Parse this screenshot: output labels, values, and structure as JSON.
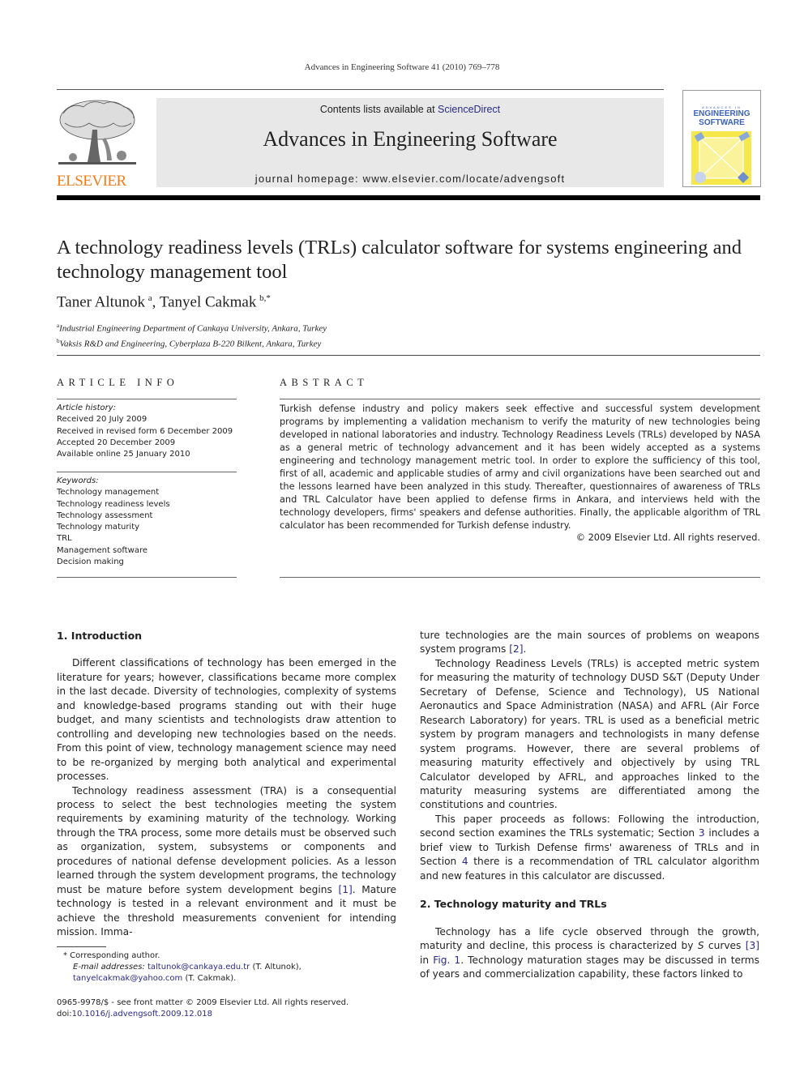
{
  "header": {
    "running_head": "Advances in Engineering Software 41 (2010) 769–778",
    "contents_prefix": "Contents lists available at ",
    "contents_link": "ScienceDirect",
    "journal_name": "Advances in Engineering Software",
    "homepage": "journal homepage: www.elsevier.com/locate/advengsoft",
    "publisher_logo_text": "ELSEVIER",
    "cover": {
      "top_line": "ADVANCES IN",
      "line1": "ENGINEERING",
      "line2": "SOFTWARE"
    },
    "colors": {
      "publisher_orange": "#f07c1a",
      "link_blue": "#2a2a8c",
      "masthead_gray": "#e8e8e8",
      "cover_yellow": "#f6e84a"
    }
  },
  "article": {
    "title": "A technology readiness levels (TRLs) calculator software for systems engineering and technology management tool",
    "authors": [
      {
        "name": "Taner Altunok",
        "sup": "a"
      },
      {
        "name": "Tanyel Cakmak",
        "sup": "b,*"
      }
    ],
    "affiliations": [
      {
        "sup": "a",
        "text": "Industrial Engineering Department of Cankaya University, Ankara, Turkey"
      },
      {
        "sup": "b",
        "text": "Vaksis R&D and Engineering, Cyberplaza B-220 Bilkent, Ankara, Turkey"
      }
    ]
  },
  "article_info": {
    "heading": "ARTICLE INFO",
    "history_label": "Article history:",
    "history": [
      "Received 20 July 2009",
      "Received in revised form 6 December 2009",
      "Accepted 20 December 2009",
      "Available online 25 January 2010"
    ],
    "keywords_label": "Keywords:",
    "keywords": [
      "Technology management",
      "Technology readiness levels",
      "Technology assessment",
      "Technology maturity",
      "TRL",
      "Management software",
      "Decision making"
    ]
  },
  "abstract": {
    "heading": "ABSTRACT",
    "text": "Turkish defense industry and policy makers seek effective and successful system development programs by implementing a validation mechanism to verify the maturity of new technologies being developed in national laboratories and industry. Technology Readiness Levels (TRLs) developed by NASA as a general metric of technology advancement and it has been widely accepted as a systems engineering and technology management metric tool. In order to explore the sufficiency of this tool, first of all, academic and applicable studies of army and civil organizations have been searched out and the lessons learned have been analyzed in this study. Thereafter, questionnaires of awareness of TRLs and TRL Calculator have been applied to defense firms in Ankara, and interviews held with the technology developers, firms' speakers and defense authorities. Finally, the applicable algorithm of TRL calculator has been recommended for Turkish defense industry.",
    "copyright": "© 2009 Elsevier Ltd. All rights reserved."
  },
  "body": {
    "section1_heading": "1. Introduction",
    "p1": "Different classifications of technology has been emerged in the literature for years; however, classifications became more complex in the last decade. Diversity of technologies, complexity of systems and knowledge-based programs standing out with their huge budget, and many scientists and technologists draw attention to controlling and developing new technologies based on the needs. From this point of view, technology management science may need to be re-organized by merging both analytical and experimental processes.",
    "p2_a": "Technology readiness assessment (TRA) is a consequential process to select the best technologies meeting the system requirements by examining maturity of the technology. Working through the TRA process, some more details must be observed such as organization, system, subsystems or components and procedures of national defense development policies. As a lesson learned through the system development programs, the technology must be mature before system development begins ",
    "p2_ref": "[1]",
    "p2_b": ". Mature technology is tested in a relevant environment and it must be achieve the threshold measurements convenient for intending mission. Immature technologies are the main sources of problems on weapons system programs ",
    "p2_ref2": "[2]",
    "p2_c": ".",
    "p3": "Technology Readiness Levels (TRLs) is accepted metric system for measuring the maturity of technology DUSD S&T (Deputy Under Secretary of Defense, Science and Technology), US National Aeronautics and Space Administration (NASA) and AFRL (Air Force Research Laboratory) for years. TRL is used as a beneficial metric system by program managers and technologists in many defense system programs. However, there are several problems of measuring maturity effectively and objectively by using TRL Calculator developed by AFRL, and approaches linked to the maturity measuring systems are differentiated among the constitutions and countries.",
    "p4_a": "This paper proceeds as follows: Following the introduction, second section examines the TRLs systematic; Section ",
    "p4_ref1": "3",
    "p4_b": " includes a brief view to Turkish Defense firms' awareness of TRLs and in Section ",
    "p4_ref2": "4",
    "p4_c": " there is a recommendation of TRL calculator algorithm and new features in this calculator are discussed.",
    "section2_heading": "2. Technology maturity and TRLs",
    "p5_a": "Technology has a life cycle observed through the growth, maturity and decline, this process is characterized by ",
    "p5_s": "S",
    "p5_b": " curves ",
    "p5_ref": "[3]",
    "p5_c": " in ",
    "p5_fig": "Fig. 1",
    "p5_d": ". Technology maturation stages may be discussed in terms of years and commercialization capability, these factors linked to"
  },
  "footnotes": {
    "star": "* Corresponding author.",
    "email_label": "E-mail addresses:",
    "email1": "taltunok@cankaya.edu.tr",
    "email1_who": " (T. Altunok), ",
    "email2": "tanyelcakmak@yahoo.com",
    "email2_who": " (T. Cakmak).",
    "issn": "0965-9978/$ - see front matter © 2009 Elsevier Ltd. All rights reserved.",
    "doi_label": "doi:",
    "doi": "10.1016/j.advengsoft.2009.12.018"
  }
}
